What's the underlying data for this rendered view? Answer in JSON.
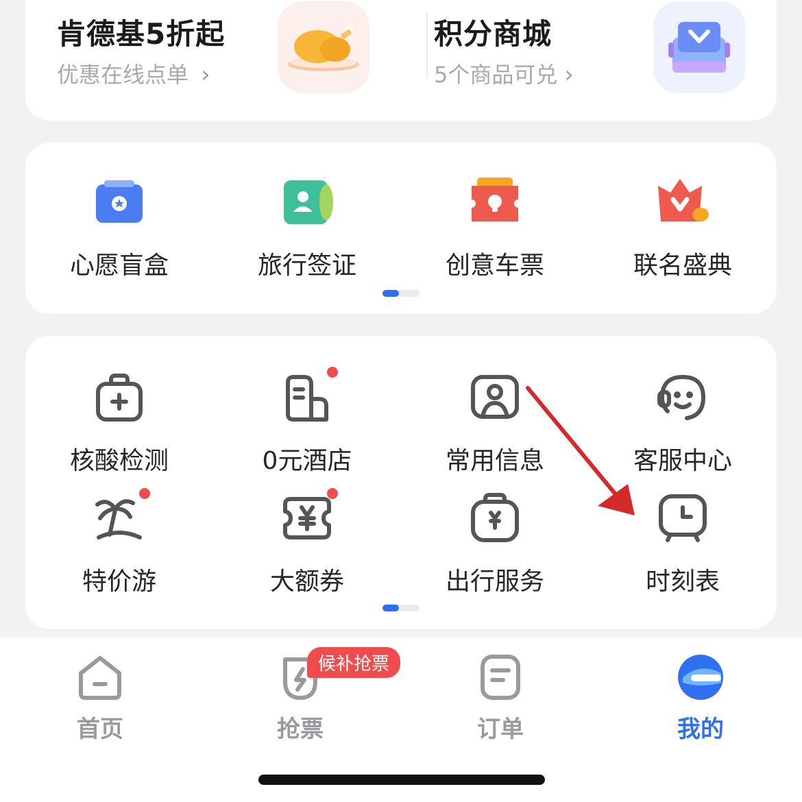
{
  "promo": {
    "left": {
      "title": "肯德基5折起",
      "subtitle": "优惠在线点单",
      "icon": "roast-chicken-icon"
    },
    "right": {
      "title": "积分商城",
      "subtitle": "5个商品可兑",
      "icon": "gift-box-icon"
    },
    "chevron": "›"
  },
  "featured": {
    "items": [
      {
        "label": "心愿盲盒",
        "icon": "blind-box-icon",
        "color": "#4a7cf2"
      },
      {
        "label": "旅行签证",
        "icon": "visa-card-icon",
        "color": "#3fbf9a"
      },
      {
        "label": "创意车票",
        "icon": "ticket-icon",
        "color": "#ef5a4e"
      },
      {
        "label": "联名盛典",
        "icon": "crown-heart-icon",
        "color": "#ef5a4e"
      }
    ],
    "page_indicator": {
      "current": 1,
      "total": 2
    }
  },
  "tools": {
    "items": [
      {
        "label": "核酸检测",
        "icon": "medical-bag-icon",
        "badge": false
      },
      {
        "label": "0元酒店",
        "icon": "hotel-card-icon",
        "badge": true
      },
      {
        "label": "常用信息",
        "icon": "contact-card-icon",
        "badge": false
      },
      {
        "label": "客服中心",
        "icon": "customer-service-icon",
        "badge": false
      },
      {
        "label": "特价游",
        "icon": "palm-island-icon",
        "badge": true
      },
      {
        "label": "大额券",
        "icon": "yuan-coupon-icon",
        "badge": true
      },
      {
        "label": "出行服务",
        "icon": "travel-bag-icon",
        "badge": false
      },
      {
        "label": "时刻表",
        "icon": "clock-icon",
        "badge": false
      }
    ],
    "page_indicator": {
      "current": 1,
      "total": 2
    }
  },
  "tabbar": {
    "tabs": [
      {
        "label": "首页",
        "icon": "home-icon",
        "active": false
      },
      {
        "label": "抢票",
        "icon": "lightning-icon",
        "active": false
      },
      {
        "label": "订单",
        "icon": "order-icon",
        "active": false
      },
      {
        "label": "我的",
        "icon": "profile-logo-icon",
        "active": true
      }
    ],
    "badge": "候补抢票"
  },
  "colors": {
    "accent": "#2f6ff0",
    "badge": "#ef4d4d",
    "annotation_arrow": "#d42a2a"
  }
}
